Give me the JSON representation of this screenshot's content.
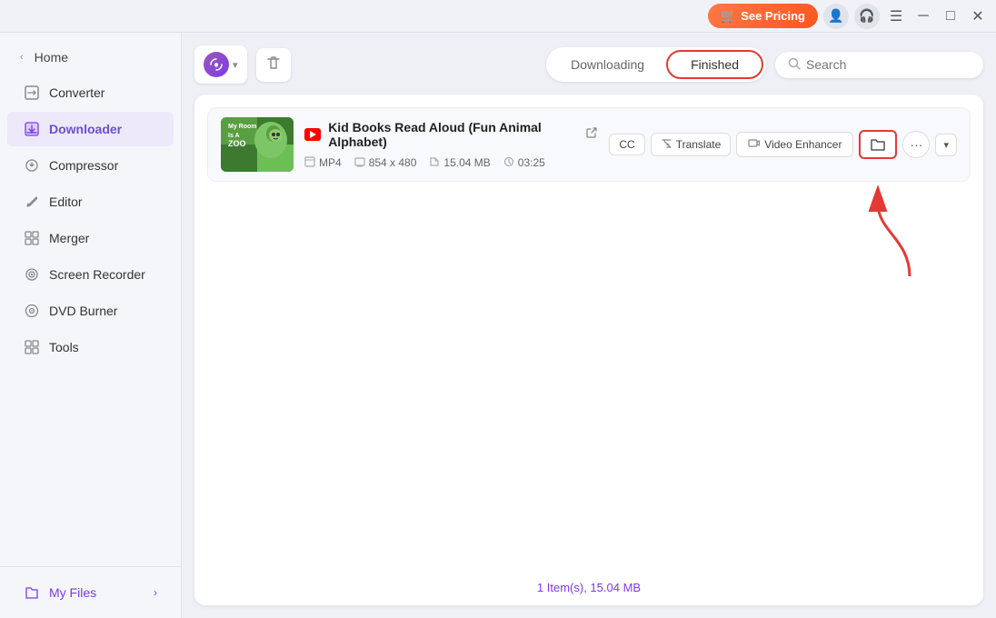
{
  "titlebar": {
    "see_pricing_label": "See Pricing",
    "cart_icon": "🛒",
    "window_controls": [
      "─",
      "□",
      "✕"
    ]
  },
  "sidebar": {
    "home_label": "Home",
    "items": [
      {
        "id": "converter",
        "label": "Converter",
        "icon": "⬛"
      },
      {
        "id": "downloader",
        "label": "Downloader",
        "icon": "⬇",
        "active": true
      },
      {
        "id": "compressor",
        "label": "Compressor",
        "icon": "🗜"
      },
      {
        "id": "editor",
        "label": "Editor",
        "icon": "✂"
      },
      {
        "id": "merger",
        "label": "Merger",
        "icon": "⊞"
      },
      {
        "id": "screen-recorder",
        "label": "Screen Recorder",
        "icon": "⊙"
      },
      {
        "id": "dvd-burner",
        "label": "DVD Burner",
        "icon": "💿"
      },
      {
        "id": "tools",
        "label": "Tools",
        "icon": "⊞"
      }
    ],
    "my_files_label": "My Files",
    "my_files_icon": "📁"
  },
  "tabs": {
    "downloading_label": "Downloading",
    "finished_label": "Finished",
    "active": "finished"
  },
  "search": {
    "placeholder": "Search"
  },
  "video_item": {
    "title": "Kid Books Read Aloud  (Fun Animal Alphabet)",
    "source": "youtube",
    "format": "MP4",
    "resolution": "854 x 480",
    "size": "15.04 MB",
    "duration": "03:25",
    "buttons": {
      "cc": "CC",
      "translate": "Translate",
      "video_enhancer": "Video Enhancer",
      "open_folder": "📁",
      "more": "···",
      "expand": "▾"
    },
    "thumbnail_text": "My Room Is A ZOO"
  },
  "status_bar": {
    "text": "1 Item(s), 15.04 MB"
  }
}
